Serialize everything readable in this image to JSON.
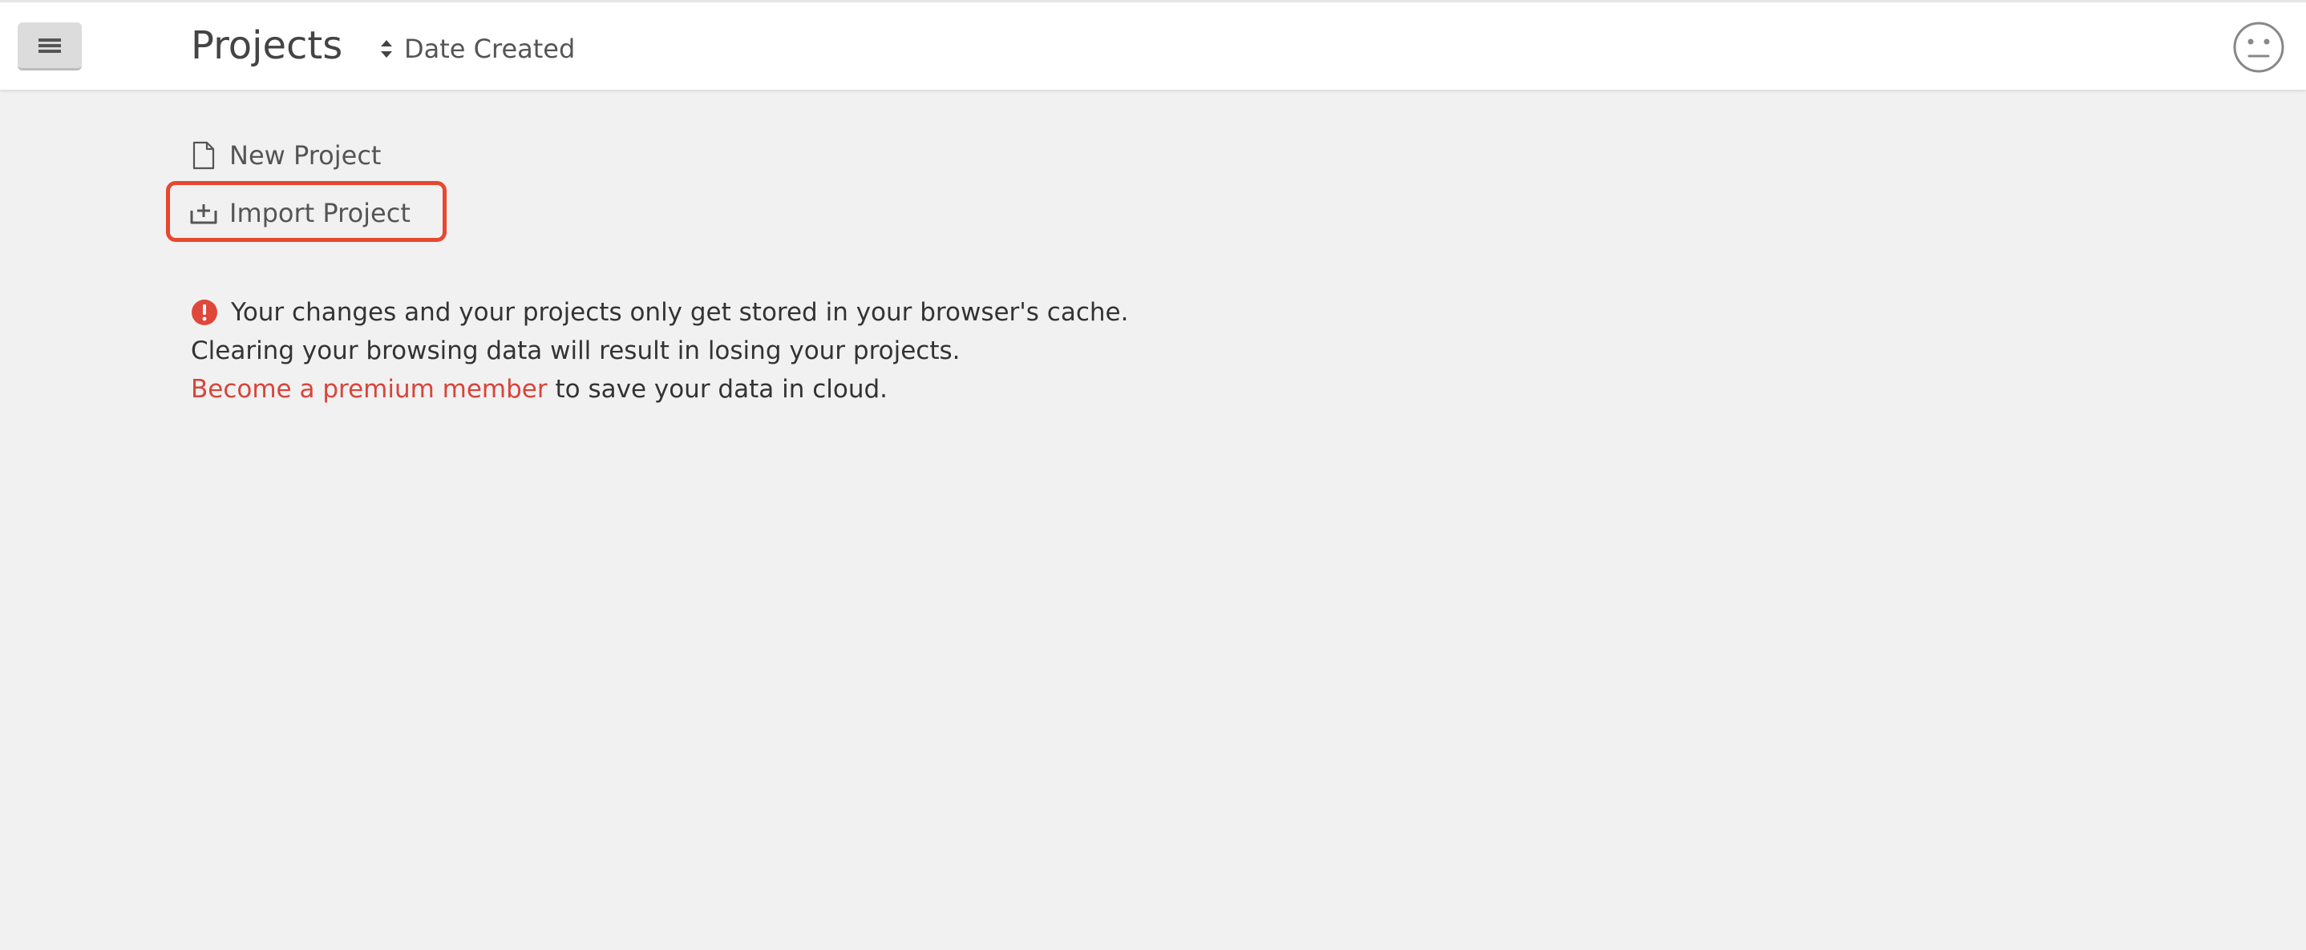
{
  "header": {
    "title": "Projects",
    "sort": {
      "label": "Date Created",
      "icon": "sort-updown-icon"
    },
    "menu_icon": "hamburger-menu-icon",
    "profile_icon": "neutral-face-icon"
  },
  "actions": [
    {
      "label": "New Project",
      "icon": "file-icon"
    },
    {
      "label": "Import Project",
      "icon": "import-tray-icon",
      "highlighted": true
    }
  ],
  "notice": {
    "line1": "Your changes and your projects only get stored in your browser's cache.",
    "line2": "Clearing your browsing data will result in losing your projects.",
    "link_text": "Become a premium member",
    "line3_suffix": " to save your data in cloud.",
    "icon": "alert-circle-icon"
  },
  "colors": {
    "accent": "#e8472f",
    "link": "#d9443a",
    "background": "#f1f1f1",
    "header": "#ffffff"
  }
}
